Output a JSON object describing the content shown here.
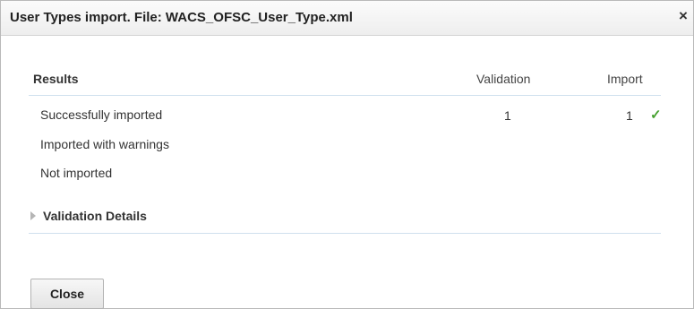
{
  "dialog": {
    "title": "User Types import. File: WACS_OFSC_User_Type.xml",
    "close_icon": "×"
  },
  "results": {
    "headers": {
      "results": "Results",
      "validation": "Validation",
      "import": "Import"
    },
    "rows": [
      {
        "label": "Successfully imported",
        "validation": "1",
        "import": "1",
        "status_icon": "✓"
      },
      {
        "label": "Imported with warnings",
        "validation": "",
        "import": ""
      },
      {
        "label": "Not imported",
        "validation": "",
        "import": ""
      }
    ]
  },
  "validation_details": {
    "label": "Validation Details",
    "expanded": false
  },
  "footer": {
    "close_label": "Close"
  },
  "colors": {
    "check": "#46a12f",
    "rule": "#cfe0ee"
  }
}
